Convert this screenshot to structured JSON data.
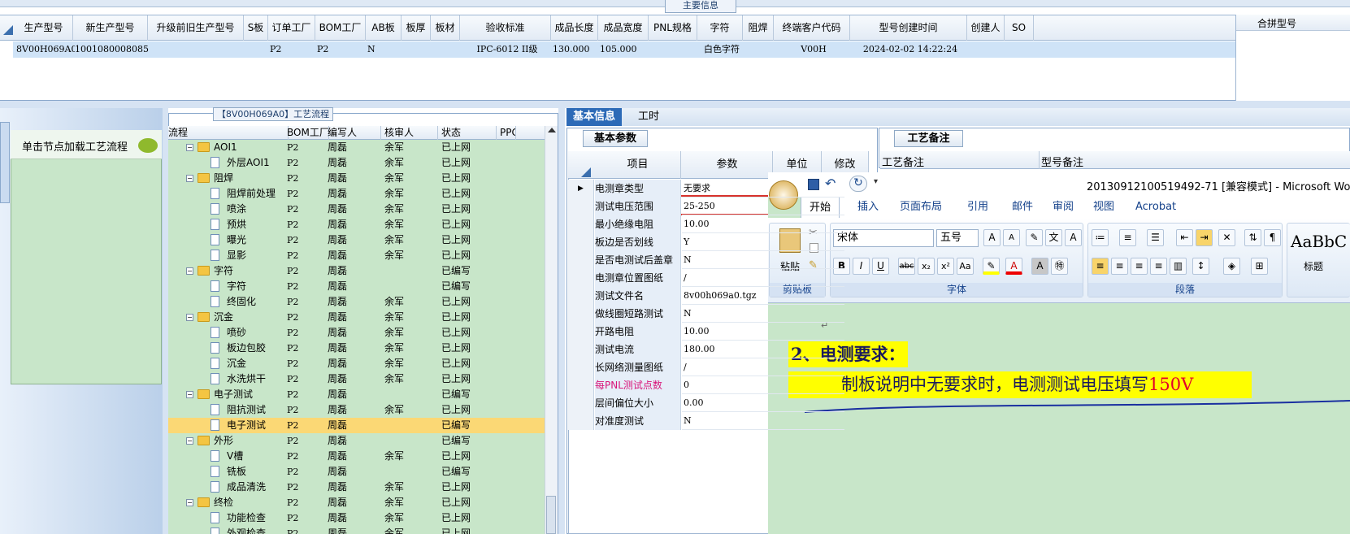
{
  "top": {
    "panel_title": "主要信息",
    "columns": [
      "生产型号",
      "新生产型号",
      "升级前旧生产型号",
      "S板",
      "订单工厂",
      "BOM工厂",
      "AB板",
      "板厚",
      "板材",
      "验收标准",
      "成品长度",
      "成品宽度",
      "PNL规格",
      "字符",
      "阻焊",
      "终端客户代码",
      "型号创建时间",
      "创建人",
      "SO"
    ],
    "row": {
      "生产型号": "8V00H069A0",
      "新生产型号": "10010800080851",
      "订单工厂": "P2",
      "BOM工厂": "P2",
      "AB板": "N",
      "验收标准": "IPC-6012 II级",
      "成品长度": "130.000",
      "成品宽度": "105.000",
      "字符": "白色字符",
      "终端客户代码": "V00H",
      "型号创建时间": "2024-02-02 14:22:24"
    },
    "right_header": "合拼型号"
  },
  "left": {
    "hint": "单击节点加载工艺流程"
  },
  "tree": {
    "title": "【8V00H069A0】工艺流程",
    "columns": [
      "流程",
      "BOM工厂",
      "编写人",
      "核审人",
      "状态",
      "PPC"
    ],
    "rows": [
      {
        "level": 1,
        "type": "folder",
        "name": "AOI1",
        "factory": "P2",
        "writer": "周磊",
        "reviewer": "余军",
        "status": "已上网"
      },
      {
        "level": 2,
        "type": "doc",
        "name": "外层AOI1",
        "factory": "P2",
        "writer": "周磊",
        "reviewer": "余军",
        "status": "已上网"
      },
      {
        "level": 1,
        "type": "folder",
        "name": "阻焊",
        "factory": "P2",
        "writer": "周磊",
        "reviewer": "余军",
        "status": "已上网"
      },
      {
        "level": 2,
        "type": "doc",
        "name": "阻焊前处理",
        "factory": "P2",
        "writer": "周磊",
        "reviewer": "余军",
        "status": "已上网"
      },
      {
        "level": 2,
        "type": "doc",
        "name": "喷涂",
        "factory": "P2",
        "writer": "周磊",
        "reviewer": "余军",
        "status": "已上网"
      },
      {
        "level": 2,
        "type": "doc",
        "name": "预烘",
        "factory": "P2",
        "writer": "周磊",
        "reviewer": "余军",
        "status": "已上网"
      },
      {
        "level": 2,
        "type": "doc",
        "name": "曝光",
        "factory": "P2",
        "writer": "周磊",
        "reviewer": "余军",
        "status": "已上网"
      },
      {
        "level": 2,
        "type": "doc",
        "name": "显影",
        "factory": "P2",
        "writer": "周磊",
        "reviewer": "余军",
        "status": "已上网"
      },
      {
        "level": 1,
        "type": "folder",
        "name": "字符",
        "factory": "P2",
        "writer": "周磊",
        "reviewer": "",
        "status": "已编写"
      },
      {
        "level": 2,
        "type": "doc",
        "name": "字符",
        "factory": "P2",
        "writer": "周磊",
        "reviewer": "",
        "status": "已编写"
      },
      {
        "level": 2,
        "type": "doc",
        "name": "终固化",
        "factory": "P2",
        "writer": "周磊",
        "reviewer": "余军",
        "status": "已上网"
      },
      {
        "level": 1,
        "type": "folder",
        "name": "沉金",
        "factory": "P2",
        "writer": "周磊",
        "reviewer": "余军",
        "status": "已上网"
      },
      {
        "level": 2,
        "type": "doc",
        "name": "喷砂",
        "factory": "P2",
        "writer": "周磊",
        "reviewer": "余军",
        "status": "已上网"
      },
      {
        "level": 2,
        "type": "doc",
        "name": "板边包胶",
        "factory": "P2",
        "writer": "周磊",
        "reviewer": "余军",
        "status": "已上网"
      },
      {
        "level": 2,
        "type": "doc",
        "name": "沉金",
        "factory": "P2",
        "writer": "周磊",
        "reviewer": "余军",
        "status": "已上网"
      },
      {
        "level": 2,
        "type": "doc",
        "name": "水洗烘干",
        "factory": "P2",
        "writer": "周磊",
        "reviewer": "余军",
        "status": "已上网"
      },
      {
        "level": 1,
        "type": "folder",
        "name": "电子测试",
        "factory": "P2",
        "writer": "周磊",
        "reviewer": "",
        "status": "已编写"
      },
      {
        "level": 2,
        "type": "doc",
        "name": "阻抗测试",
        "factory": "P2",
        "writer": "周磊",
        "reviewer": "余军",
        "status": "已上网"
      },
      {
        "level": 2,
        "type": "doc",
        "name": "电子测试",
        "factory": "P2",
        "writer": "周磊",
        "reviewer": "",
        "status": "已编写",
        "selected": true
      },
      {
        "level": 1,
        "type": "folder",
        "name": "外形",
        "factory": "P2",
        "writer": "周磊",
        "reviewer": "",
        "status": "已编写"
      },
      {
        "level": 2,
        "type": "doc",
        "name": "V槽",
        "factory": "P2",
        "writer": "周磊",
        "reviewer": "余军",
        "status": "已上网"
      },
      {
        "level": 2,
        "type": "doc",
        "name": "铣板",
        "factory": "P2",
        "writer": "周磊",
        "reviewer": "",
        "status": "已编写"
      },
      {
        "level": 2,
        "type": "doc",
        "name": "成品清洗",
        "factory": "P2",
        "writer": "周磊",
        "reviewer": "余军",
        "status": "已上网"
      },
      {
        "level": 1,
        "type": "folder",
        "name": "终检",
        "factory": "P2",
        "writer": "周磊",
        "reviewer": "余军",
        "status": "已上网"
      },
      {
        "level": 2,
        "type": "doc",
        "name": "功能检查",
        "factory": "P2",
        "writer": "周磊",
        "reviewer": "余军",
        "status": "已上网"
      },
      {
        "level": 2,
        "type": "doc",
        "name": "外观检查",
        "factory": "P2",
        "writer": "周磊",
        "reviewer": "余军",
        "status": "已上网"
      }
    ]
  },
  "info": {
    "tabs": [
      "基本信息",
      "工时"
    ],
    "params_tab": "基本参数",
    "columns": [
      "项目",
      "参数",
      "单位",
      "修改"
    ],
    "rows": [
      {
        "item": "电测章类型",
        "value": "无要求",
        "current": true
      },
      {
        "item": "测试电压范围",
        "value": "25-250"
      },
      {
        "item": "最小绝缘电阻",
        "value": "10.00"
      },
      {
        "item": "板边是否划线",
        "value": "Y"
      },
      {
        "item": "是否电测试后盖章",
        "value": "N"
      },
      {
        "item": "电测章位置图纸",
        "value": "/"
      },
      {
        "item": "测试文件名",
        "value": "8v00h069a0.tgz"
      },
      {
        "item": "做线圈短路测试",
        "value": "N"
      },
      {
        "item": "开路电阻",
        "value": "10.00"
      },
      {
        "item": "测试电流",
        "value": "180.00"
      },
      {
        "item": "长网络测量图纸",
        "value": "/"
      },
      {
        "item": "每PNL测试点数",
        "value": "0",
        "highlight": true
      },
      {
        "item": "层间偏位大小",
        "value": "0.00"
      },
      {
        "item": "对准度测试",
        "value": "N"
      }
    ]
  },
  "notes": {
    "tab": "工艺备注",
    "col1": "工艺备注",
    "col2": "型号备注"
  },
  "word": {
    "title": "20130912100519492-71 [兼容模式] - Microsoft Word",
    "tabs": [
      "开始",
      "插入",
      "页面布局",
      "引用",
      "邮件",
      "审阅",
      "视图",
      "Acrobat"
    ],
    "font_name": "宋体",
    "font_size": "五号",
    "groups": {
      "clipboard": "剪贴板",
      "font": "字体",
      "paragraph": "段落"
    },
    "paste_label": "粘贴",
    "style_preview": "AaBbC",
    "style_label": "标题",
    "doc_heading": "2、电测要求：",
    "doc_text": "制板说明中无要求时，电测测试电压填写",
    "doc_text_red": "150V"
  },
  "colors": {
    "accent": "#2c6ab7",
    "tree_bg": "#c8e6c9",
    "selected_row": "#fbd875",
    "highlight_text": "#d9167a",
    "annotation_red": "#d8332c"
  }
}
